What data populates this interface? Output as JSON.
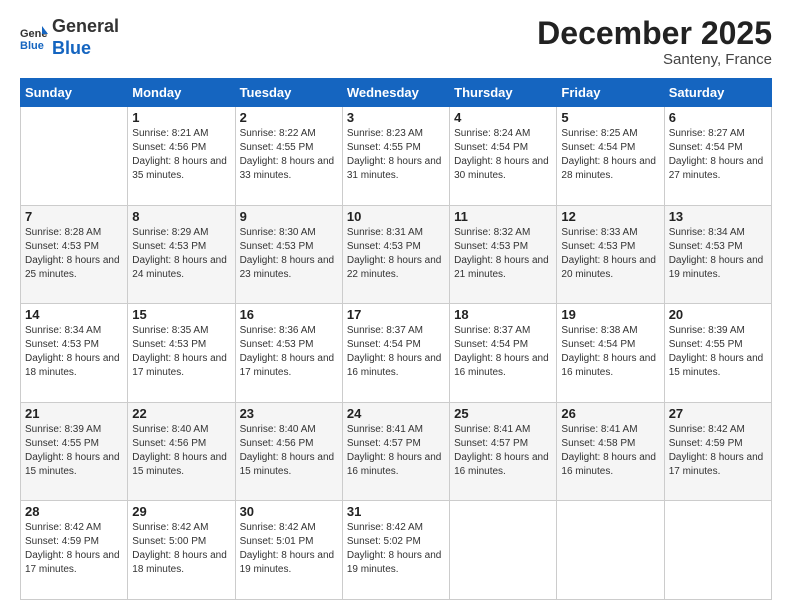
{
  "header": {
    "logo_general": "General",
    "logo_blue": "Blue",
    "month_title": "December 2025",
    "location": "Santeny, France"
  },
  "days_of_week": [
    "Sunday",
    "Monday",
    "Tuesday",
    "Wednesday",
    "Thursday",
    "Friday",
    "Saturday"
  ],
  "weeks": [
    [
      null,
      {
        "day": 1,
        "sunrise": "8:21 AM",
        "sunset": "4:56 PM",
        "daylight": "8 hours and 35 minutes."
      },
      {
        "day": 2,
        "sunrise": "8:22 AM",
        "sunset": "4:55 PM",
        "daylight": "8 hours and 33 minutes."
      },
      {
        "day": 3,
        "sunrise": "8:23 AM",
        "sunset": "4:55 PM",
        "daylight": "8 hours and 31 minutes."
      },
      {
        "day": 4,
        "sunrise": "8:24 AM",
        "sunset": "4:54 PM",
        "daylight": "8 hours and 30 minutes."
      },
      {
        "day": 5,
        "sunrise": "8:25 AM",
        "sunset": "4:54 PM",
        "daylight": "8 hours and 28 minutes."
      },
      {
        "day": 6,
        "sunrise": "8:27 AM",
        "sunset": "4:54 PM",
        "daylight": "8 hours and 27 minutes."
      }
    ],
    [
      {
        "day": 7,
        "sunrise": "8:28 AM",
        "sunset": "4:53 PM",
        "daylight": "8 hours and 25 minutes."
      },
      {
        "day": 8,
        "sunrise": "8:29 AM",
        "sunset": "4:53 PM",
        "daylight": "8 hours and 24 minutes."
      },
      {
        "day": 9,
        "sunrise": "8:30 AM",
        "sunset": "4:53 PM",
        "daylight": "8 hours and 23 minutes."
      },
      {
        "day": 10,
        "sunrise": "8:31 AM",
        "sunset": "4:53 PM",
        "daylight": "8 hours and 22 minutes."
      },
      {
        "day": 11,
        "sunrise": "8:32 AM",
        "sunset": "4:53 PM",
        "daylight": "8 hours and 21 minutes."
      },
      {
        "day": 12,
        "sunrise": "8:33 AM",
        "sunset": "4:53 PM",
        "daylight": "8 hours and 20 minutes."
      },
      {
        "day": 13,
        "sunrise": "8:34 AM",
        "sunset": "4:53 PM",
        "daylight": "8 hours and 19 minutes."
      }
    ],
    [
      {
        "day": 14,
        "sunrise": "8:34 AM",
        "sunset": "4:53 PM",
        "daylight": "8 hours and 18 minutes."
      },
      {
        "day": 15,
        "sunrise": "8:35 AM",
        "sunset": "4:53 PM",
        "daylight": "8 hours and 17 minutes."
      },
      {
        "day": 16,
        "sunrise": "8:36 AM",
        "sunset": "4:53 PM",
        "daylight": "8 hours and 17 minutes."
      },
      {
        "day": 17,
        "sunrise": "8:37 AM",
        "sunset": "4:54 PM",
        "daylight": "8 hours and 16 minutes."
      },
      {
        "day": 18,
        "sunrise": "8:37 AM",
        "sunset": "4:54 PM",
        "daylight": "8 hours and 16 minutes."
      },
      {
        "day": 19,
        "sunrise": "8:38 AM",
        "sunset": "4:54 PM",
        "daylight": "8 hours and 16 minutes."
      },
      {
        "day": 20,
        "sunrise": "8:39 AM",
        "sunset": "4:55 PM",
        "daylight": "8 hours and 15 minutes."
      }
    ],
    [
      {
        "day": 21,
        "sunrise": "8:39 AM",
        "sunset": "4:55 PM",
        "daylight": "8 hours and 15 minutes."
      },
      {
        "day": 22,
        "sunrise": "8:40 AM",
        "sunset": "4:56 PM",
        "daylight": "8 hours and 15 minutes."
      },
      {
        "day": 23,
        "sunrise": "8:40 AM",
        "sunset": "4:56 PM",
        "daylight": "8 hours and 15 minutes."
      },
      {
        "day": 24,
        "sunrise": "8:41 AM",
        "sunset": "4:57 PM",
        "daylight": "8 hours and 16 minutes."
      },
      {
        "day": 25,
        "sunrise": "8:41 AM",
        "sunset": "4:57 PM",
        "daylight": "8 hours and 16 minutes."
      },
      {
        "day": 26,
        "sunrise": "8:41 AM",
        "sunset": "4:58 PM",
        "daylight": "8 hours and 16 minutes."
      },
      {
        "day": 27,
        "sunrise": "8:42 AM",
        "sunset": "4:59 PM",
        "daylight": "8 hours and 17 minutes."
      }
    ],
    [
      {
        "day": 28,
        "sunrise": "8:42 AM",
        "sunset": "4:59 PM",
        "daylight": "8 hours and 17 minutes."
      },
      {
        "day": 29,
        "sunrise": "8:42 AM",
        "sunset": "5:00 PM",
        "daylight": "8 hours and 18 minutes."
      },
      {
        "day": 30,
        "sunrise": "8:42 AM",
        "sunset": "5:01 PM",
        "daylight": "8 hours and 19 minutes."
      },
      {
        "day": 31,
        "sunrise": "8:42 AM",
        "sunset": "5:02 PM",
        "daylight": "8 hours and 19 minutes."
      },
      null,
      null,
      null
    ]
  ]
}
